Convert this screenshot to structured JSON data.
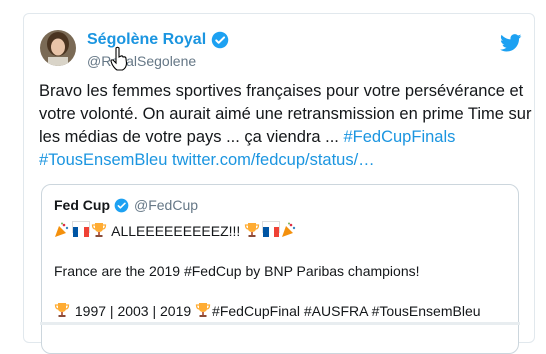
{
  "tweet": {
    "author_name": "Ségolène Royal",
    "author_handle": "@RoyalSegolene",
    "handle_visible": "@R alSegolene",
    "text_lines": [
      "Bravo les femmes sportives françaises pour votre persévérance et",
      "votre volonté. On aurait aimé une retransmission en prime Time sur",
      "les médias de votre pays ... ça viendra ... "
    ],
    "hashtag_fedcupfinals": "#FedCupFinals",
    "hashtag_tousensembleu": "#TousEnsemBleu",
    "link": "twitter.com/fedcup/status/…"
  },
  "quoted": {
    "author_name": "Fed Cup",
    "author_handle": "@FedCup",
    "line1_text": "ALLEEEEEEEEEZ!!!",
    "line2_text": "France are the 2019 #FedCup by BNP Paribas champions!",
    "line3_text": "1997 | 2003 | 2019 ",
    "line3_tags": "#FedCupFinal #AUSFRA #TousEnsemBleu"
  },
  "colors": {
    "accent": "#1b95e0",
    "muted": "#657786",
    "text": "#14171a"
  },
  "icons": [
    "verified-badge-icon",
    "twitter-bird-icon",
    "hand-cursor-icon",
    "party-popper-icon",
    "french-flag-icon",
    "trophy-icon"
  ]
}
